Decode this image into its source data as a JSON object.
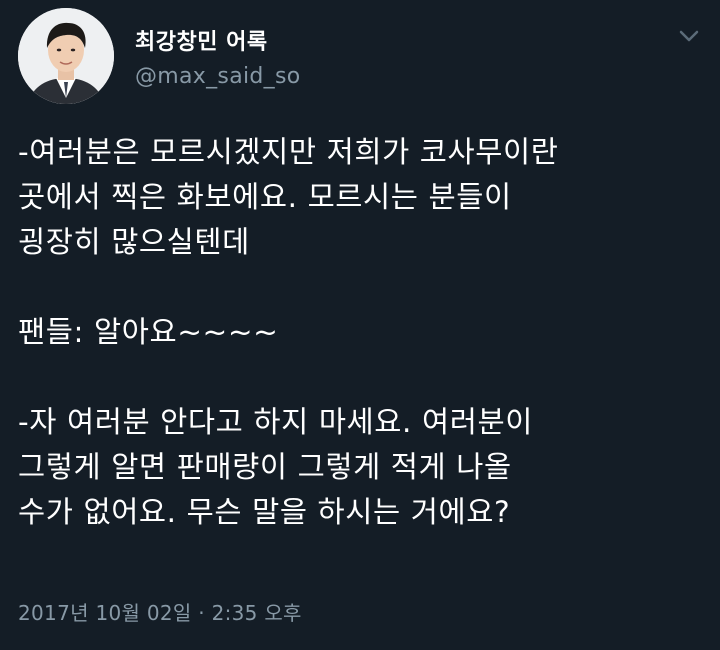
{
  "author": {
    "display_name": "최강창민 어록",
    "handle": "@max_said_so"
  },
  "tweet": {
    "paragraph1": [
      "-여러분은 모르시겠지만 저희가 코사무이란",
      "곳에서 찍은 화보에요. 모르시는 분들이",
      "굉장히 많으실텐데"
    ],
    "paragraph2": [
      "팬들: 알아요~~~~"
    ],
    "paragraph3": [
      "-자 여러분 안다고 하지 마세요. 여러분이",
      "그렇게 알면 판매량이 그렇게 적게 나올",
      "수가 없어요. 무슨 말을 하시는 거에요?"
    ]
  },
  "timestamp": "2017년 10월 02일 · 2:35 오후",
  "colors": {
    "background": "#141d26",
    "text": "#ffffff",
    "muted": "#8899a6"
  },
  "icons": {
    "avatar": "profile-photo",
    "menu": "chevron-down-icon"
  }
}
